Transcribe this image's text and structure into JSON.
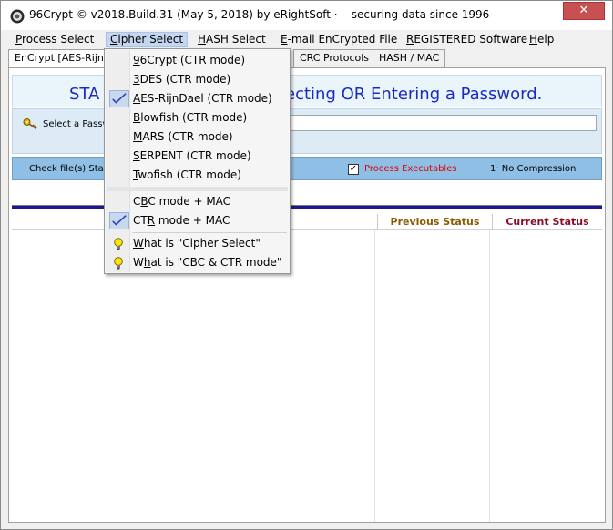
{
  "window": {
    "title": "96Crypt © v2018.Build.31 (May 5, 2018) by eRightSoft ·    securing data since 1996",
    "close_label": "✕"
  },
  "menubar": {
    "items": [
      {
        "label": "Process Select",
        "underline": "P",
        "rest": "rocess Select"
      },
      {
        "label": "Cipher Select",
        "underline": "C",
        "rest": "ipher Select"
      },
      {
        "label": "HASH Select",
        "underline": "H",
        "rest": "ASH Select"
      },
      {
        "label": "E-mail EnCrypted File",
        "underline": "E",
        "rest": "-mail EnCrypted File"
      },
      {
        "label": "REGISTERED Software",
        "underline": "R",
        "rest": "EGISTERED Software"
      },
      {
        "label": "Help",
        "underline": "H",
        "rest": "elp"
      }
    ]
  },
  "tabs": [
    {
      "label": "EnCrypt [AES-RijnDa"
    },
    {
      "label": "CRC Protocols"
    },
    {
      "label": "HASH / MAC"
    }
  ],
  "main": {
    "banner_left": "STA",
    "banner_right": "lecting OR Entering a Password.",
    "password_label": "Select a Passw",
    "status_label": "Check file(s) Stat",
    "process_executables_label": "Process Executables",
    "process_executables_checked": true,
    "compression_label": "1· No Compression"
  },
  "file_list": {
    "columns": [
      "Previous Status",
      "Current Status"
    ]
  },
  "cipher_menu": {
    "items": [
      {
        "label": "96Crypt (CTR mode)",
        "ul": "9",
        "rest": "6Crypt (CTR mode)",
        "checked": false
      },
      {
        "label": "3DES (CTR mode)",
        "ul": "3",
        "rest": "DES (CTR mode)",
        "checked": false
      },
      {
        "label": "AES-RijnDael (CTR mode)",
        "ul": "A",
        "rest": "ES-RijnDael (CTR mode)",
        "checked": true
      },
      {
        "label": "Blowfish (CTR mode)",
        "ul": "B",
        "rest": "lowfish (CTR mode)",
        "checked": false
      },
      {
        "label": "MARS (CTR mode)",
        "ul": "M",
        "rest": "ARS (CTR mode)",
        "checked": false
      },
      {
        "label": "SERPENT (CTR mode)",
        "ul": "S",
        "rest": "ERPENT (CTR mode)",
        "checked": false
      },
      {
        "label": "Twofish (CTR mode)",
        "ul": "T",
        "rest": "wofish (CTR mode)",
        "checked": false
      }
    ],
    "mode_items": [
      {
        "label": "CBC mode + MAC",
        "pre": "C",
        "ul": "B",
        "rest": "C mode + MAC",
        "checked": false
      },
      {
        "label": "CTR mode + MAC",
        "pre": "CT",
        "ul": "R",
        "rest": " mode + MAC",
        "checked": true
      }
    ],
    "help_items": [
      {
        "label": "What is \"Cipher Select\"",
        "pre": "",
        "ul": "W",
        "rest": "hat is \"Cipher Select\""
      },
      {
        "label": "What is \"CBC & CTR mode\"",
        "pre": "W",
        "ul": "h",
        "rest": "at is \"CBC & CTR mode\""
      }
    ]
  },
  "colors": {
    "banner_text": "#1a2bbf",
    "status_bar": "#8fbfe4",
    "exec_label": "#e00000",
    "col_prev": "#8a5a00",
    "col_curr": "#8a0a2a",
    "divider": "#1a1a8c"
  },
  "icons": {
    "app": "padlock-disc-icon",
    "key": "key-icon",
    "check": "checkmark-icon",
    "help": "lightbulb-icon"
  }
}
